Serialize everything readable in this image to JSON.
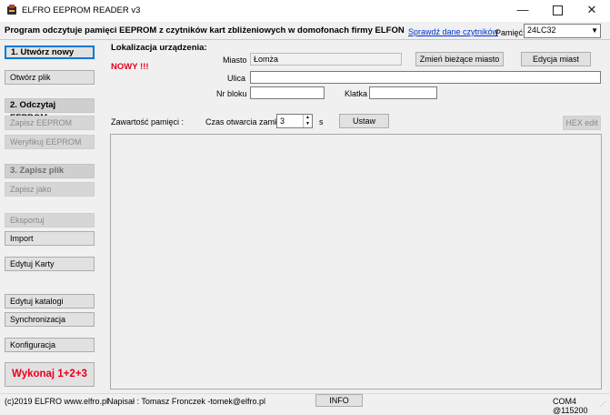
{
  "window": {
    "title": "ELFRO EEPROM READER v3"
  },
  "header": {
    "description": "Program odczytuje pamięci EEPROM z czytników kart zbliżeniowych w domofonach firmy ELFON",
    "check_readers_link": "Sprawdź dane czytników",
    "memory_label": "Pamięć:",
    "memory_value": "24LC32"
  },
  "sidebar": {
    "new_button": "1. Utwórz nowy",
    "open_file": "Otwórz plik",
    "read_section": "2. Odczytaj EEPROM",
    "save_eeprom": "Zapisz EEPROM",
    "verify_eeprom": "Weryfikuj EEPROM",
    "save_section": "3. Zapisz plik",
    "save_as": "Zapisz jako",
    "export": "Eksportuj",
    "import": "Import",
    "edit_cards": "Edytuj Karty",
    "edit_catalogs": "Edytuj  katalogi",
    "sync": "Synchronizacja",
    "config": "Konfiguracja",
    "run_all": "Wykonaj 1+2+3"
  },
  "location": {
    "heading": "Lokalizacja urządzenia:",
    "new_badge": "NOWY !!!",
    "city_label": "Miasto",
    "city_value": "Łomża",
    "change_city_button": "Zmień bieżące miasto",
    "edit_cities_button": "Edycja miast",
    "street_label": "Ulica",
    "street_value": "",
    "block_label": "Nr bloku",
    "block_value": "",
    "stairwell_label": "Klatka",
    "stairwell_value": ""
  },
  "memory": {
    "contents_label": "Zawartość pamięci :",
    "lock_time_label": "Czas otwarcia zamka :",
    "lock_time_value": "3",
    "lock_time_unit": "s",
    "set_button": "Ustaw",
    "hex_edit_button": "HEX edit"
  },
  "status": {
    "copyright": "(c)2019 ELFRO www.elfro.pl",
    "author": "Napisał : Tomasz Fronczek  -tomek@elfro.pl",
    "info_button": "INFO",
    "port": "COM4 @115200"
  }
}
